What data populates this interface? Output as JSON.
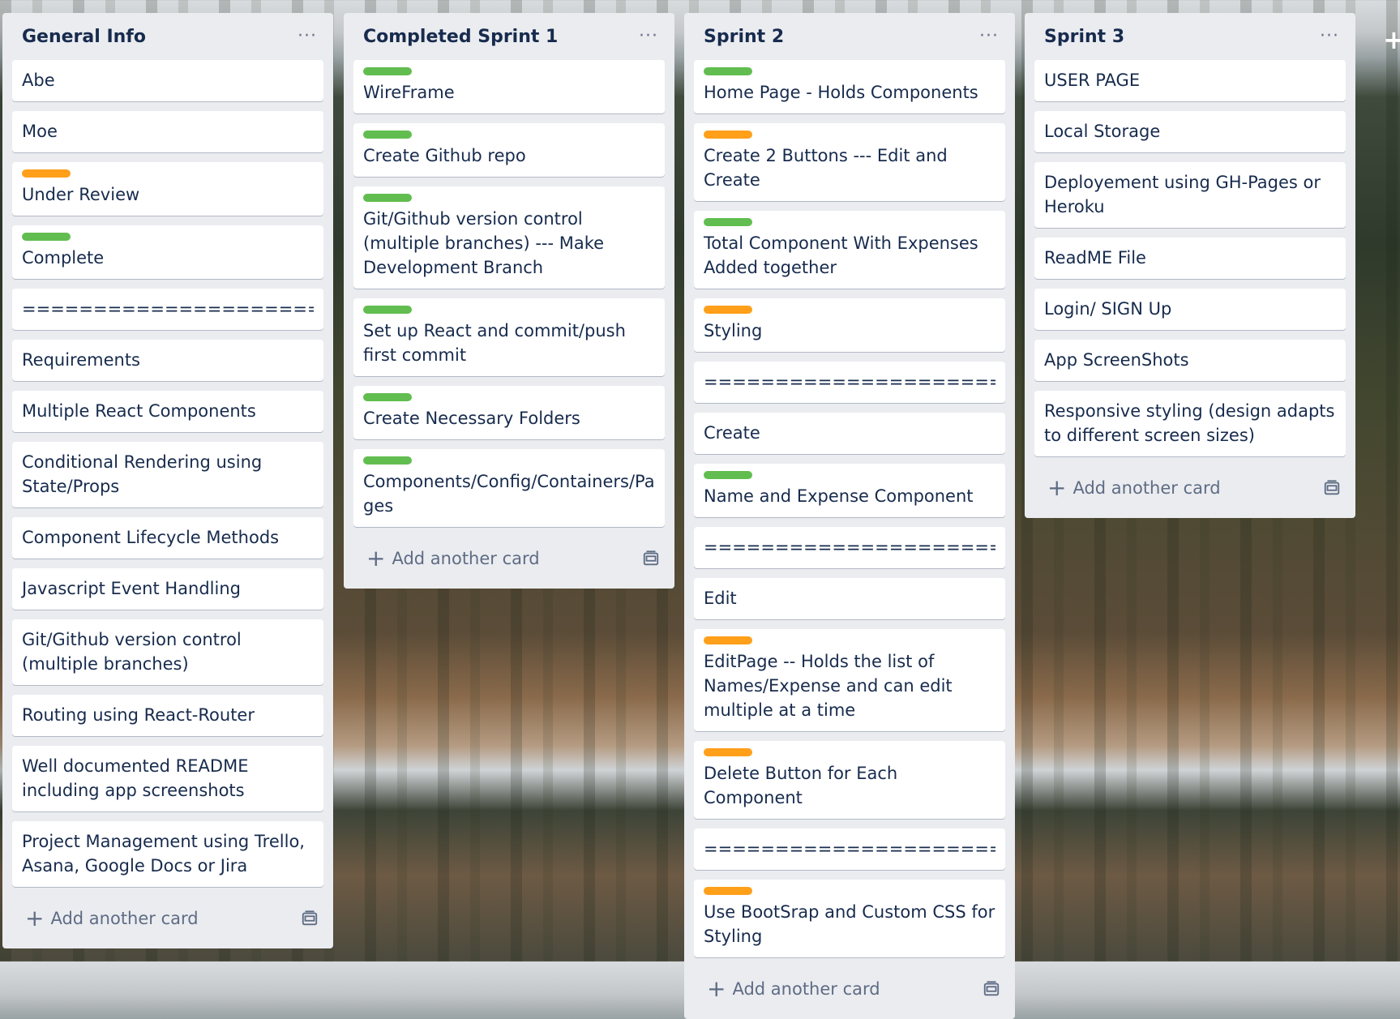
{
  "colors": {
    "green": "#61bd4f",
    "orange": "#ff9f1a"
  },
  "add_list_icon": "plus-icon",
  "lists": [
    {
      "title": "General Info",
      "menu": "···",
      "add_card": "Add another card",
      "cards": [
        {
          "text": "Abe"
        },
        {
          "text": "Moe"
        },
        {
          "label": "orange",
          "text": "Under Review"
        },
        {
          "label": "green",
          "text": "Complete"
        },
        {
          "text": "======================",
          "sep": true
        },
        {
          "text": "Requirements"
        },
        {
          "text": "Multiple React Components"
        },
        {
          "text": "Conditional Rendering using State/Props"
        },
        {
          "text": "Component Lifecycle Methods"
        },
        {
          "text": "Javascript Event Handling"
        },
        {
          "text": "Git/Github version control (multiple branches)"
        },
        {
          "text": "Routing using React-Router"
        },
        {
          "text": "Well documented README including app screenshots"
        },
        {
          "text": "Project Management using Trello, Asana, Google Docs or Jira"
        }
      ]
    },
    {
      "title": "Completed Sprint 1",
      "menu": "···",
      "add_card": "Add another card",
      "cards": [
        {
          "label": "green",
          "text": "WireFrame"
        },
        {
          "label": "green",
          "text": "Create Github repo"
        },
        {
          "label": "green",
          "text": "Git/Github version control (multiple branches) --- Make Development Branch"
        },
        {
          "label": "green",
          "text": "Set up React and commit/push first commit"
        },
        {
          "label": "green",
          "text": "Create Necessary Folders"
        },
        {
          "label": "green",
          "text": "Components/Config/Containers/Pages"
        }
      ]
    },
    {
      "title": "Sprint 2",
      "menu": "···",
      "add_card": "Add another card",
      "cards": [
        {
          "label": "green",
          "text": "Home Page - Holds Components"
        },
        {
          "label": "orange",
          "text": "Create 2 Buttons --- Edit and Create"
        },
        {
          "label": "green",
          "text": "Total Component With Expenses Added together"
        },
        {
          "label": "orange",
          "text": "Styling"
        },
        {
          "text": "======================",
          "sep": true
        },
        {
          "text": "Create"
        },
        {
          "label": "green",
          "text": "Name and Expense Component"
        },
        {
          "text": "======================",
          "sep": true
        },
        {
          "text": "Edit"
        },
        {
          "label": "orange",
          "text": "EditPage -- Holds the list of Names/Expense and can edit multiple at a time"
        },
        {
          "label": "orange",
          "text": "Delete Button for Each Component"
        },
        {
          "text": "======================",
          "sep": true
        },
        {
          "label": "orange",
          "text": "Use BootSrap and Custom CSS for Styling"
        }
      ]
    },
    {
      "title": "Sprint 3",
      "menu": "···",
      "add_card": "Add another card",
      "cards": [
        {
          "text": "USER PAGE"
        },
        {
          "text": "Local Storage"
        },
        {
          "text": "Deployement using GH-Pages or Heroku"
        },
        {
          "text": "ReadME File"
        },
        {
          "text": "Login/ SIGN Up"
        },
        {
          "text": "App ScreenShots"
        },
        {
          "text": "Responsive styling (design adapts to different screen sizes)"
        }
      ]
    }
  ]
}
